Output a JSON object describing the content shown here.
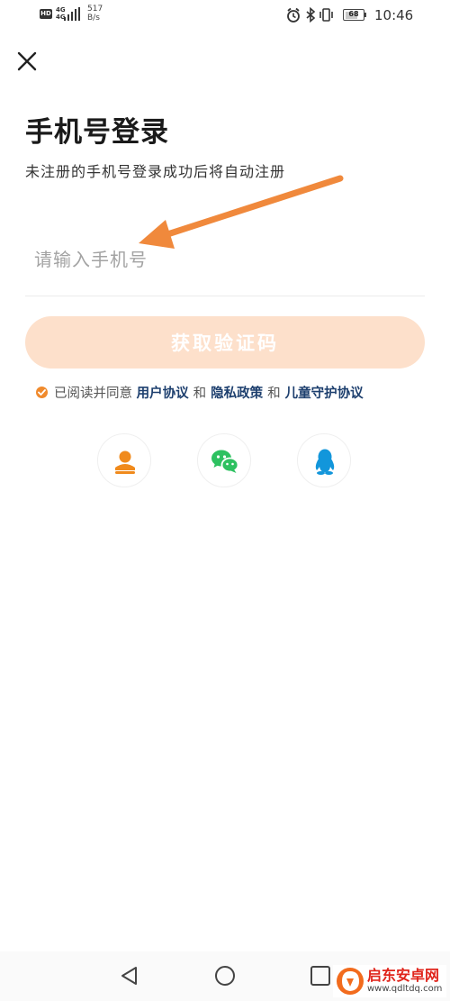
{
  "status_bar": {
    "hd": "HD",
    "network": "4G",
    "network2": "4G",
    "speed_value": "517",
    "speed_unit": "B/s",
    "battery": "68",
    "time": "10:46"
  },
  "header": {
    "title": "手机号登录",
    "subtitle": "未注册的手机号登录成功后将自动注册"
  },
  "form": {
    "phone_placeholder": "请输入手机号",
    "phone_value": "",
    "get_code_label": "获取验证码"
  },
  "agreement": {
    "prefix": "已阅读并同意",
    "user_agreement": "用户协议",
    "and1": "和",
    "privacy_policy": "隐私政策",
    "and2": "和",
    "child_protection": "儿童守护协议",
    "checked": true
  },
  "social_login": [
    {
      "name": "account",
      "icon": "person-icon",
      "color": "#f08a1c"
    },
    {
      "name": "wechat",
      "icon": "wechat-icon",
      "color": "#2dc160"
    },
    {
      "name": "qq",
      "icon": "qq-icon",
      "color": "#1296db"
    }
  ],
  "colors": {
    "accent": "#f08a2c",
    "button_disabled_bg": "#fde0cb",
    "link": "#1d3f6e",
    "arrow": "#f0893c"
  },
  "watermark": {
    "name": "启东安卓网",
    "url": "www.qdltdq.com"
  }
}
